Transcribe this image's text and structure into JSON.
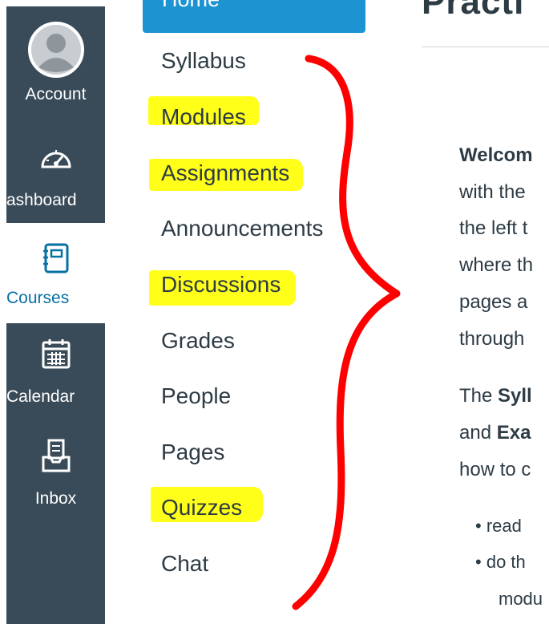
{
  "global_nav": {
    "items": [
      {
        "label": "Account",
        "icon": "account-avatar-icon"
      },
      {
        "label": "ashboard",
        "icon": "dashboard-gauge-icon"
      },
      {
        "label": "Courses",
        "icon": "courses-book-icon",
        "active": true
      },
      {
        "label": "Calendar",
        "icon": "calendar-icon"
      },
      {
        "label": "Inbox",
        "icon": "inbox-tray-icon"
      }
    ]
  },
  "course_nav": {
    "home": "Home",
    "items": [
      {
        "label": "Syllabus",
        "highlighted": false
      },
      {
        "label": "Modules",
        "highlighted": true
      },
      {
        "label": "Assignments",
        "highlighted": true
      },
      {
        "label": "Announcements",
        "highlighted": false
      },
      {
        "label": "Discussions",
        "highlighted": true
      },
      {
        "label": "Grades",
        "highlighted": false
      },
      {
        "label": "People",
        "highlighted": false
      },
      {
        "label": "Pages",
        "highlighted": false
      },
      {
        "label": "Quizzes",
        "highlighted": true
      },
      {
        "label": "Chat",
        "highlighted": false
      }
    ]
  },
  "content": {
    "title": "Practi",
    "lines": [
      "Welcom",
      "with the",
      "the left t",
      "where th",
      "pages a",
      "through",
      "The Syll",
      "and Exa",
      "how to c"
    ],
    "bullets": [
      "read",
      "do th",
      "modu"
    ]
  },
  "colors": {
    "nav_bg": "#394b58",
    "accent": "#0770a3",
    "home_bg": "#1e93d2",
    "highlight": "#ffff1a",
    "annotation_red": "#ff0000"
  }
}
